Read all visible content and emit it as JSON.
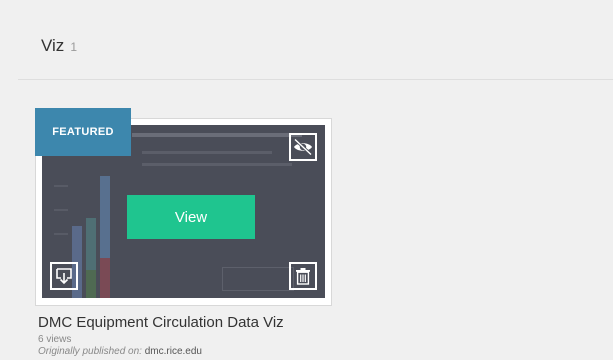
{
  "section": {
    "title": "Viz",
    "count": "1"
  },
  "card": {
    "badge": "FEATURED",
    "view_label": "View",
    "title": "DMC Equipment Circulation Data Viz",
    "views": "6 views",
    "origin_label": "Originally published on:",
    "origin_domain": "dmc.rice.edu",
    "icons": {
      "hide": "eye-slash-icon",
      "download": "download-icon",
      "delete": "trash-icon"
    }
  },
  "colors": {
    "badge": "#3d87ad",
    "view_button": "#1fc58f",
    "thumbnail_overlay": "#4a4d58"
  }
}
